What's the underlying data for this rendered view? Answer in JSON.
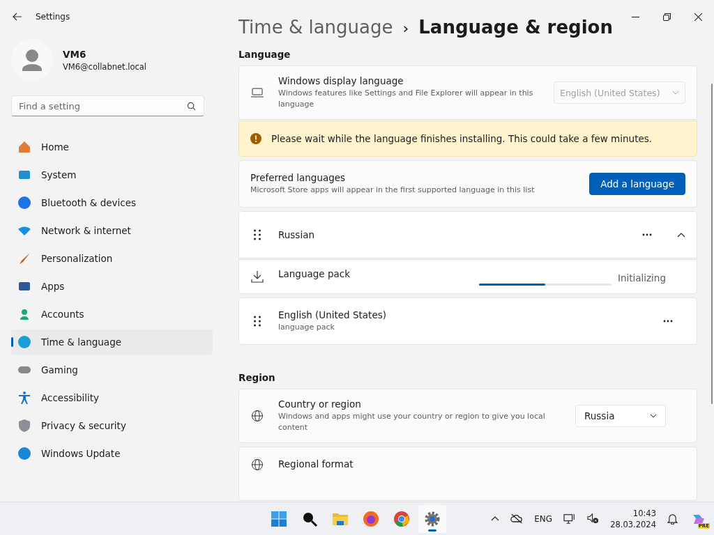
{
  "window": {
    "title": "Settings"
  },
  "user": {
    "name": "VM6",
    "email": "VM6@collabnet.local"
  },
  "search": {
    "placeholder": "Find a setting"
  },
  "nav": [
    {
      "label": "Home",
      "selected": false
    },
    {
      "label": "System",
      "selected": false
    },
    {
      "label": "Bluetooth & devices",
      "selected": false
    },
    {
      "label": "Network & internet",
      "selected": false
    },
    {
      "label": "Personalization",
      "selected": false
    },
    {
      "label": "Apps",
      "selected": false
    },
    {
      "label": "Accounts",
      "selected": false
    },
    {
      "label": "Time & language",
      "selected": true
    },
    {
      "label": "Gaming",
      "selected": false
    },
    {
      "label": "Accessibility",
      "selected": false
    },
    {
      "label": "Privacy & security",
      "selected": false
    },
    {
      "label": "Windows Update",
      "selected": false
    }
  ],
  "breadcrumb": {
    "parent": "Time & language",
    "separator": "›",
    "current": "Language & region"
  },
  "language_section": {
    "heading": "Language",
    "display_language": {
      "title": "Windows display language",
      "description": "Windows features like Settings and File Explorer will appear in this language",
      "value": "English (United States)",
      "disabled": true
    },
    "warning": "Please wait while the language finishes installing. This could take a few minutes.",
    "preferred": {
      "title": "Preferred languages",
      "description": "Microsoft Store apps will appear in the first supported language in this list",
      "button": "Add a language"
    },
    "languages": [
      {
        "name": "Russian",
        "expanded": true,
        "detail": {
          "title": "Language pack",
          "level": 0.5,
          "status": "Initializing"
        }
      },
      {
        "name": "English (United States)",
        "subtitle": "language pack"
      }
    ]
  },
  "region_section": {
    "heading": "Region",
    "country": {
      "title": "Country or region",
      "description": "Windows and apps might use your country or region to give you local content",
      "value": "Russia"
    },
    "format": {
      "title": "Regional format"
    }
  },
  "taskbar": {
    "apps": [
      {
        "selected": false
      },
      {
        "selected": false
      },
      {
        "selected": false
      },
      {
        "selected": false
      },
      {
        "selected": false
      },
      {
        "selected": true
      }
    ],
    "language": "ENG",
    "time": "10:43",
    "date": "28.03.2024",
    "badge": "PRE"
  }
}
